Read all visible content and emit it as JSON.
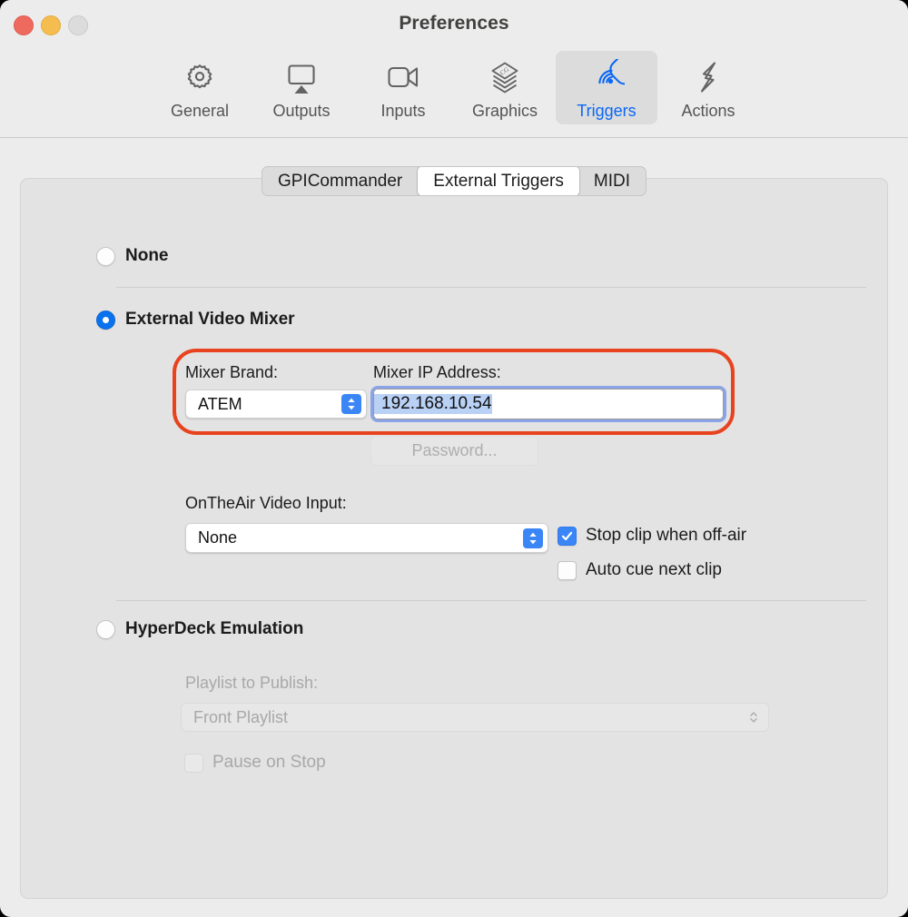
{
  "window": {
    "title": "Preferences",
    "traffic_lights": [
      {
        "name": "close",
        "color": "#ee6a5f"
      },
      {
        "name": "minimize",
        "color": "#f5bd4f"
      },
      {
        "name": "zoom",
        "color": "#dcdcdc"
      }
    ]
  },
  "toolbar": {
    "items": [
      {
        "label": "General",
        "icon": "gear-icon",
        "selected": false
      },
      {
        "label": "Outputs",
        "icon": "airplay-icon",
        "selected": false
      },
      {
        "label": "Inputs",
        "icon": "video-camera-icon",
        "selected": false
      },
      {
        "label": "Graphics",
        "icon": "layers-cg-icon",
        "selected": false
      },
      {
        "label": "Triggers",
        "icon": "wireless-tag-icon",
        "selected": true
      },
      {
        "label": "Actions",
        "icon": "lightning-bolt-icon",
        "selected": false
      }
    ],
    "selected_index": 4,
    "accent_color": "#0a67f5"
  },
  "tabs": {
    "items": [
      {
        "label": "GPICommander",
        "active": false
      },
      {
        "label": "External Triggers",
        "active": true
      },
      {
        "label": "MIDI",
        "active": false
      }
    ],
    "active_index": 1
  },
  "form": {
    "mode_options": [
      {
        "label": "None",
        "selected": false
      },
      {
        "label": "External Video Mixer",
        "selected": true
      },
      {
        "label": "HyperDeck Emulation",
        "selected": false
      }
    ],
    "mixer_brand": {
      "label": "Mixer Brand:",
      "value": "ATEM",
      "enabled": true
    },
    "mixer_ip": {
      "label": "Mixer IP Address:",
      "value": "192.168.10.54",
      "focused": true,
      "selected_text": true
    },
    "password_button": {
      "label": "Password...",
      "enabled": false
    },
    "video_input": {
      "label": "OnTheAir Video Input:",
      "value": "None",
      "enabled": true
    },
    "checkboxes": [
      {
        "label": "Stop clip when off-air",
        "checked": true,
        "enabled": true
      },
      {
        "label": "Auto cue next clip",
        "checked": false,
        "enabled": true
      }
    ],
    "playlist_to_publish": {
      "label": "Playlist to Publish:",
      "value": "Front Playlist",
      "enabled": false
    },
    "pause_on_stop": {
      "label": "Pause on Stop",
      "checked": false,
      "enabled": false
    }
  },
  "annotation": {
    "highlight_color": "#e8431f",
    "target": "mixer-brand-and-ip-group"
  }
}
